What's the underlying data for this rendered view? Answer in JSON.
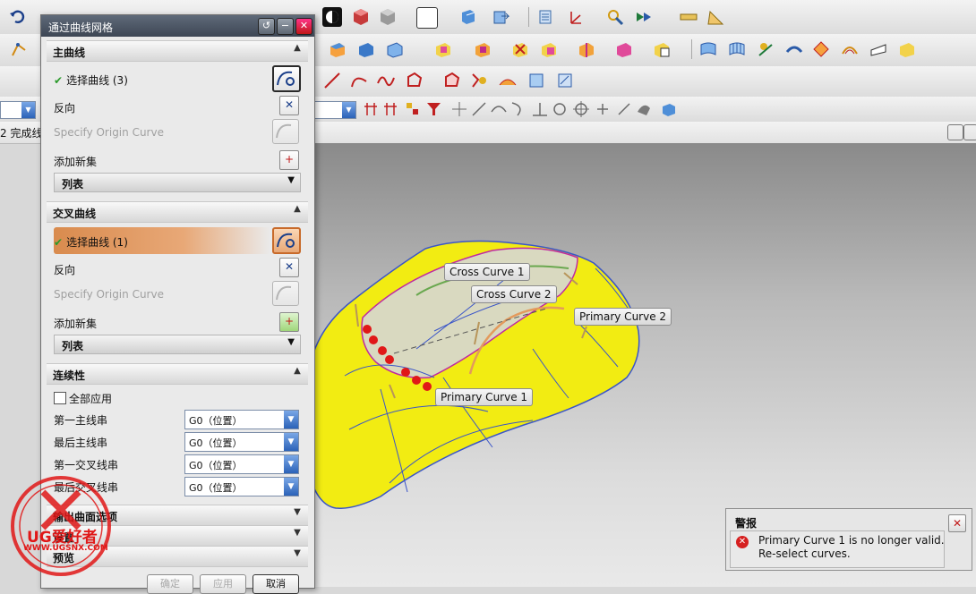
{
  "dialog": {
    "title": "通过曲线网格",
    "primary": {
      "header": "主曲线",
      "select_curve": "选择曲线 (3)",
      "reverse": "反向",
      "origin_curve": "Specify Origin Curve",
      "add_set": "添加新集",
      "list": "列表"
    },
    "cross": {
      "header": "交叉曲线",
      "select_curve": "选择曲线 (1)",
      "reverse": "反向",
      "origin_curve": "Specify Origin Curve",
      "add_set": "添加新集",
      "list": "列表"
    },
    "continuity": {
      "header": "连续性",
      "apply_all": "全部应用",
      "first_primary": "第一主线串",
      "last_primary": "最后主线串",
      "first_cross": "第一交叉线串",
      "last_cross": "最后交叉线串",
      "value": "G0（位置）"
    },
    "output_options": "输出曲面选项",
    "settings": "设置",
    "preview": "预览",
    "ok": "确定",
    "apply": "应用",
    "cancel": "取消"
  },
  "status_text": "2 完成线",
  "viewport_labels": {
    "cross1": "Cross Curve  1",
    "cross2": "Cross Curve  2",
    "primary2": "Primary Curve  2",
    "primary1": "Primary Curve  1"
  },
  "alert": {
    "title": "警报",
    "line1": "Primary Curve 1 is no longer valid.",
    "line2": "Re-select curves."
  },
  "watermark": {
    "brand": "UG爱好者",
    "url": "WWW.UGSNX.COM"
  },
  "colors": {
    "surface": "#f2ec12",
    "accent_orange": "#e39a5c",
    "title_bar": "#4a5462",
    "error_red": "#d62020"
  }
}
